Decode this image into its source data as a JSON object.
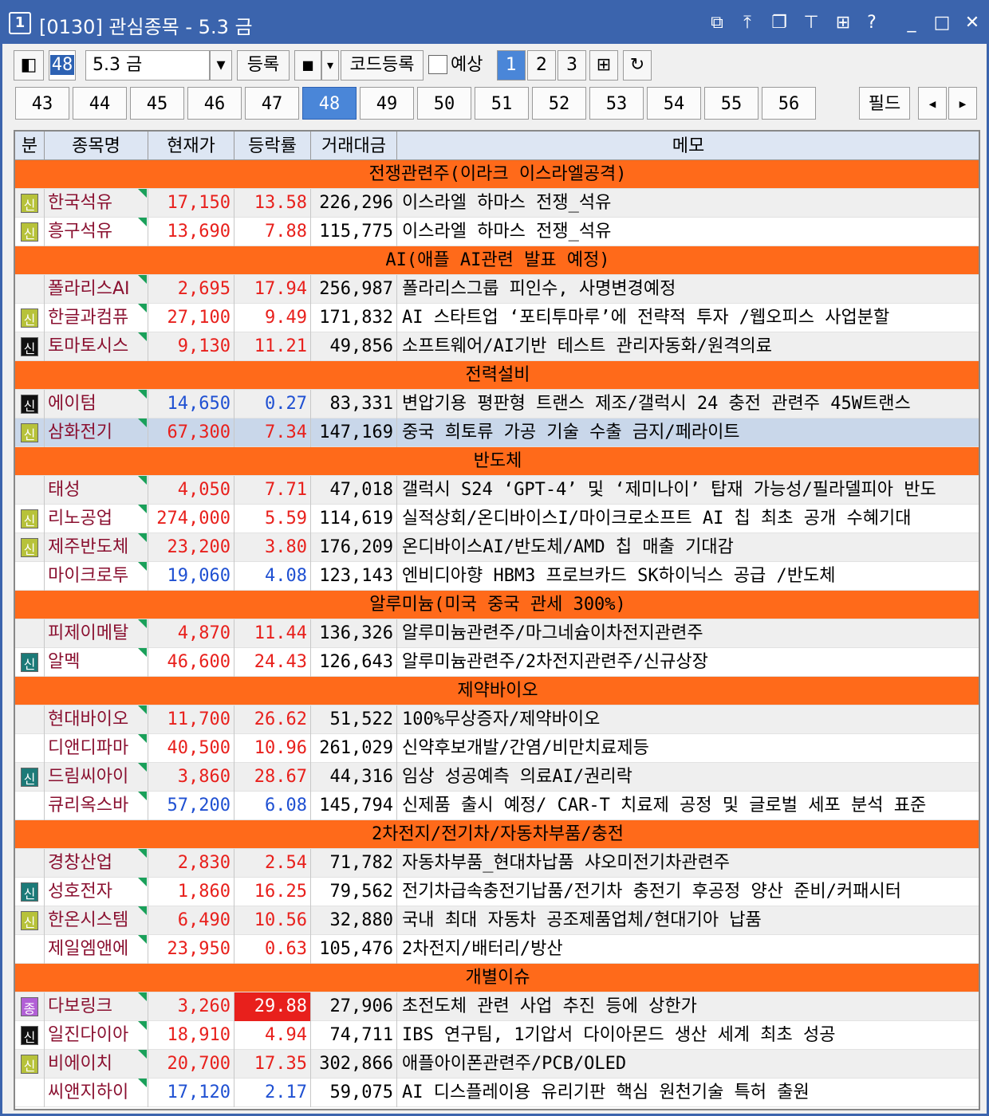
{
  "window": {
    "number": "1",
    "title": "[0130] 관심종목 - 5.3 금"
  },
  "titlebar_icons": [
    {
      "icon": "restore-window-icon",
      "glyph": "⧉"
    },
    {
      "icon": "pin-top-icon",
      "glyph": "⤒"
    },
    {
      "icon": "cascade-icon",
      "glyph": "❐"
    },
    {
      "icon": "pushpin-icon",
      "glyph": "⊤"
    },
    {
      "icon": "grid-icon",
      "glyph": "⊞"
    },
    {
      "icon": "help-icon",
      "glyph": "?"
    },
    {
      "icon": "minimize-icon",
      "glyph": "_"
    },
    {
      "icon": "maximize-icon",
      "glyph": "□"
    },
    {
      "icon": "close-icon",
      "glyph": "✕"
    }
  ],
  "toolbar": {
    "group_number": "48",
    "group_name": "5.3 금",
    "register_label": "등록",
    "square_label": "■",
    "code_register_label": "코드등록",
    "forecast_label": "예상",
    "views": [
      "1",
      "2",
      "3"
    ],
    "active_view": "1"
  },
  "pages": [
    "43",
    "44",
    "45",
    "46",
    "47",
    "48",
    "49",
    "50",
    "51",
    "52",
    "53",
    "54",
    "55",
    "56"
  ],
  "active_page": "48",
  "field_label": "필드",
  "headers": [
    "분",
    "종목명",
    "현재가",
    "등락률",
    "거래대금",
    "메모"
  ],
  "colors": {
    "group": "#ff6a1a",
    "up": "#e8201c",
    "down": "#1f50d2",
    "selected": "#c9d7ea",
    "stripe": "#efefef",
    "tag_credit": "#b7c23a",
    "tag_black": "#111111",
    "tag_teal": "#1c7a78",
    "tag_purple": "#b25fd6"
  },
  "rows": [
    {
      "group": "전쟁관련주(이라크 이스라엘공격)"
    },
    {
      "tag": "신",
      "tagc": "tag_credit",
      "name": "한국석유",
      "price": "17,150",
      "rate": "13.58",
      "dir": "up",
      "amount": "226,296",
      "memo": "이스라엘 하마스 전쟁_석유"
    },
    {
      "tag": "신",
      "tagc": "tag_credit",
      "name": "흥구석유",
      "price": "13,690",
      "rate": "7.88",
      "dir": "up",
      "amount": "115,775",
      "memo": "이스라엘 하마스 전쟁_석유"
    },
    {
      "group": "AI(애플 AI관련 발표 예정)"
    },
    {
      "tag": "",
      "name": "폴라리스AI",
      "price": "2,695",
      "rate": "17.94",
      "dir": "up",
      "amount": "256,987",
      "memo": "폴라리스그룹 피인수, 사명변경예정"
    },
    {
      "tag": "신",
      "tagc": "tag_credit",
      "name": "한글과컴퓨",
      "price": "27,100",
      "rate": "9.49",
      "dir": "up",
      "amount": "171,832",
      "memo": "AI 스타트업 ‘포티투마루’에 전략적 투자 /웹오피스 사업분할"
    },
    {
      "tag": "신",
      "tagc": "tag_black",
      "name": "토마토시스",
      "price": "9,130",
      "rate": "11.21",
      "dir": "up",
      "amount": "49,856",
      "memo": "소프트웨어/AI기반 테스트 관리자동화/원격의료"
    },
    {
      "group": "전력설비"
    },
    {
      "tag": "신",
      "tagc": "tag_black",
      "name": "에이텀",
      "price": "14,650",
      "rate": "0.27",
      "dir": "dn",
      "amount": "83,331",
      "memo": "변압기용 평판형 트랜스 제조/갤럭시 24 충전 관련주 45W트랜스"
    },
    {
      "tag": "신",
      "tagc": "tag_credit",
      "name": "삼화전기",
      "price": "67,300",
      "rate": "7.34",
      "dir": "up",
      "amount": "147,169",
      "memo": "중국 희토류 가공 기술 수출 금지/페라이트",
      "selected": true
    },
    {
      "group": "반도체"
    },
    {
      "tag": "",
      "name": "태성",
      "price": "4,050",
      "rate": "7.71",
      "dir": "up",
      "amount": "47,018",
      "memo": "갤럭시 S24 ‘GPT-4’ 및 ‘제미나이’ 탑재 가능성/필라델피아 반도"
    },
    {
      "tag": "신",
      "tagc": "tag_credit",
      "name": "리노공업",
      "price": "274,000",
      "rate": "5.59",
      "dir": "up",
      "amount": "114,619",
      "memo": "실적상회/온디바이스I/마이크로소프트 AI 칩 최초 공개 수혜기대"
    },
    {
      "tag": "신",
      "tagc": "tag_credit",
      "name": "제주반도체",
      "price": "23,200",
      "rate": "3.80",
      "dir": "up",
      "amount": "176,209",
      "memo": "온디바이스AI/반도체/AMD 칩 매출 기대감"
    },
    {
      "tag": "",
      "name": "마이크로투",
      "price": "19,060",
      "rate": "4.08",
      "dir": "dn",
      "amount": "123,143",
      "memo": "엔비디아향 HBM3 프로브카드 SK하이닉스 공급 /반도체"
    },
    {
      "group": "알루미늄(미국 중국 관세 300%)"
    },
    {
      "tag": "",
      "name": "피제이메탈",
      "price": "4,870",
      "rate": "11.44",
      "dir": "up",
      "amount": "136,326",
      "memo": "알루미늄관련주/마그네슘이차전지관련주"
    },
    {
      "tag": "신",
      "tagc": "tag_teal",
      "name": "알멕",
      "price": "46,600",
      "rate": "24.43",
      "dir": "up",
      "amount": "126,643",
      "memo": "알루미늄관련주/2차전지관련주/신규상장"
    },
    {
      "group": "제약바이오"
    },
    {
      "tag": "",
      "name": "현대바이오",
      "price": "11,700",
      "rate": "26.62",
      "dir": "up",
      "amount": "51,522",
      "memo": "100%무상증자/제약바이오"
    },
    {
      "tag": "",
      "name": "디앤디파마",
      "price": "40,500",
      "rate": "10.96",
      "dir": "up",
      "amount": "261,029",
      "memo": "신약후보개발/간염/비만치료제등"
    },
    {
      "tag": "신",
      "tagc": "tag_teal",
      "name": "드림씨아이",
      "price": "3,860",
      "rate": "28.67",
      "dir": "up",
      "amount": "44,316",
      "memo": "임상 성공예측 의료AI/권리락"
    },
    {
      "tag": "",
      "name": "큐리옥스바",
      "price": "57,200",
      "rate": "6.08",
      "dir": "dn",
      "amount": "145,794",
      "memo": "신제품 출시 예정/ CAR-T 치료제 공정 및 글로벌 세포 분석 표준"
    },
    {
      "group": "2차전지/전기차/자동차부품/충전"
    },
    {
      "tag": "",
      "name": "경창산업",
      "price": "2,830",
      "rate": "2.54",
      "dir": "up",
      "amount": "71,782",
      "memo": "자동차부품_현대차납품 샤오미전기차관련주"
    },
    {
      "tag": "신",
      "tagc": "tag_teal",
      "name": "성호전자",
      "price": "1,860",
      "rate": "16.25",
      "dir": "up",
      "amount": "79,562",
      "memo": "전기차급속충전기납품/전기차 충전기 후공정 양산 준비/커패시터"
    },
    {
      "tag": "신",
      "tagc": "tag_credit",
      "name": "한온시스템",
      "price": "6,490",
      "rate": "10.56",
      "dir": "up",
      "amount": "32,880",
      "memo": "국내 최대 자동차 공조제품업체/현대기아 납품"
    },
    {
      "tag": "",
      "name": "제일엠앤에",
      "price": "23,950",
      "rate": "0.63",
      "dir": "up",
      "amount": "105,476",
      "memo": "2차전지/배터리/방산"
    },
    {
      "group": "개별이슈"
    },
    {
      "tag": "종",
      "tagc": "tag_purple",
      "name": "다보링크",
      "price": "3,260",
      "rate": "29.88",
      "dir": "up",
      "limit": true,
      "amount": "27,906",
      "memo": "초전도체 관련 사업 추진 등에 상한가"
    },
    {
      "tag": "신",
      "tagc": "tag_black",
      "name": "일진다이아",
      "price": "18,910",
      "rate": "4.94",
      "dir": "up",
      "amount": "74,711",
      "memo": "IBS 연구팀, 1기압서 다이아몬드 생산 세계 최초 성공"
    },
    {
      "tag": "신",
      "tagc": "tag_credit",
      "name": "비에이치",
      "price": "20,700",
      "rate": "17.35",
      "dir": "up",
      "amount": "302,866",
      "memo": "애플아이폰관련주/PCB/OLED"
    },
    {
      "tag": "",
      "name": "씨앤지하이",
      "price": "17,120",
      "rate": "2.17",
      "dir": "dn",
      "amount": "59,075",
      "memo": "AI 디스플레이용 유리기판 핵심 원천기술 특허 출원"
    }
  ]
}
